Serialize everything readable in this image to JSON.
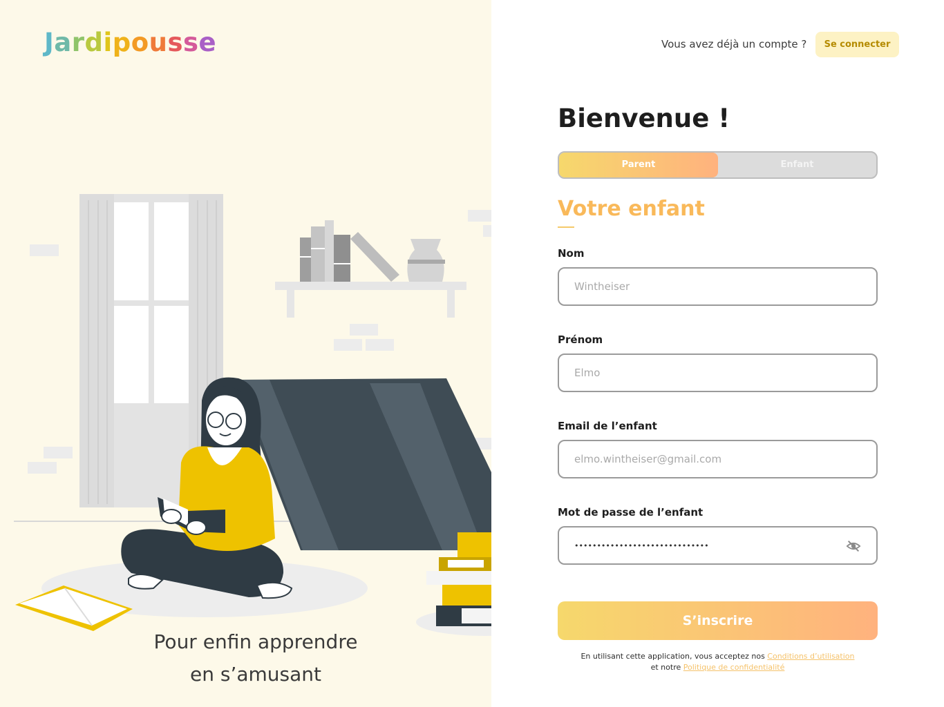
{
  "brand": {
    "name": "Jardipousse",
    "letters": [
      {
        "ch": "J",
        "color": "#5fb8c8"
      },
      {
        "ch": "a",
        "color": "#6fb9a8"
      },
      {
        "ch": "r",
        "color": "#8fc46a"
      },
      {
        "ch": "d",
        "color": "#b9c93f"
      },
      {
        "ch": "i",
        "color": "#e0c51a"
      },
      {
        "ch": "p",
        "color": "#efb21a"
      },
      {
        "ch": "o",
        "color": "#f39a24"
      },
      {
        "ch": "u",
        "color": "#ef7a3a"
      },
      {
        "ch": "s",
        "color": "#e5595b"
      },
      {
        "ch": "s",
        "color": "#d45a9a"
      },
      {
        "ch": "e",
        "color": "#a95fc6"
      }
    ]
  },
  "hero": {
    "tagline_line1": "Pour enfin apprendre",
    "tagline_line2": "en s’amusant"
  },
  "header": {
    "already_text": "Vous avez déjà un compte ?",
    "login_label": "Se connecter"
  },
  "form": {
    "title": "Bienvenue !",
    "tabs": [
      {
        "label": "Parent",
        "active": true
      },
      {
        "label": "Enfant",
        "active": false
      }
    ],
    "section_title": "Votre enfant",
    "fields": {
      "nom": {
        "label": "Nom",
        "placeholder": "Wintheiser"
      },
      "prenom": {
        "label": "Prénom",
        "placeholder": "Elmo"
      },
      "email": {
        "label": "Email de l’enfant",
        "placeholder": "elmo.wintheiser@gmail.com"
      },
      "password": {
        "label": "Mot de passe de l’enfant",
        "value": "••••••••••••••••••••••••••••••",
        "toggle_icon": "eye-off-icon"
      }
    },
    "submit_label": "S’inscrire",
    "legal": {
      "prefix": "En utilisant cette application, vous acceptez nos ",
      "terms_link": "Conditions d’utilisation",
      "middle": "et notre ",
      "privacy_link": "Politique de confidentialité"
    }
  },
  "colors": {
    "left_bg": "#fdf9e9",
    "accent_gradient_start": "#f6d86c",
    "accent_gradient_end": "#ffb27e",
    "section_title": "#f9b95a",
    "illustration_yellow": "#eec200",
    "illustration_dark": "#2f3b44"
  }
}
